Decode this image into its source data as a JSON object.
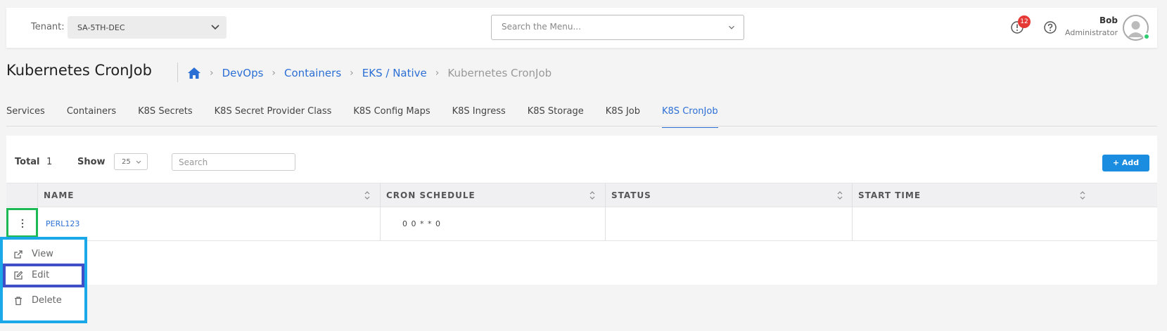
{
  "header": {
    "tenant_label": "Tenant:",
    "tenant_value": "SA-5TH-DEC",
    "menu_search_placeholder": "Search the Menu...",
    "notification_count": "12",
    "user_name": "Bob",
    "user_role": "Administrator"
  },
  "page": {
    "title": "Kubernetes CronJob",
    "breadcrumbs": [
      "DevOps",
      "Containers",
      "EKS / Native",
      "Kubernetes CronJob"
    ]
  },
  "tabs": [
    "Services",
    "Containers",
    "K8S Secrets",
    "K8S Secret Provider Class",
    "K8S Config Maps",
    "K8S Ingress",
    "K8S Storage",
    "K8S Job",
    "K8S CronJob"
  ],
  "active_tab": "K8S CronJob",
  "table_controls": {
    "total_label": "Total",
    "total_value": "1",
    "show_label": "Show",
    "show_value": "25",
    "search_placeholder": "Search",
    "add_label": "Add"
  },
  "table": {
    "columns": [
      "NAME",
      "CRON SCHEDULE",
      "STATUS",
      "START TIME"
    ],
    "rows": [
      {
        "name": "PERL123",
        "cron_schedule": "0 0 * * 0",
        "status": "",
        "start_time": ""
      }
    ]
  },
  "row_menu": {
    "items": [
      "View",
      "Edit",
      "Delete"
    ]
  },
  "colors": {
    "accent": "#2c6fd4",
    "add_button": "#1a8de0",
    "badge": "#e53935",
    "kebab_highlight": "#1db954",
    "menu_highlight": "#1aa8e8",
    "edit_highlight": "#3f4fc7"
  }
}
